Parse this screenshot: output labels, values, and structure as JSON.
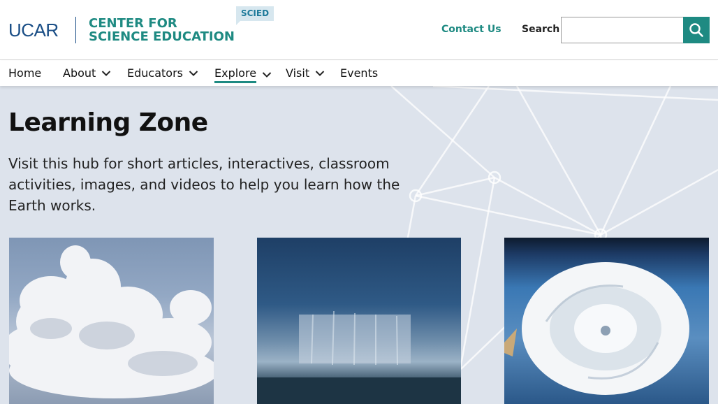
{
  "header": {
    "logo_text": "UCAR",
    "center_line1": "CENTER FOR",
    "center_line2": "SCIENCE EDUCATION",
    "badge": "SCIED",
    "contact_label": "Contact Us",
    "search_label": "Search",
    "search_value": "",
    "colors": {
      "brand_teal": "#1e8a82",
      "ucar_blue": "#1a4e86"
    }
  },
  "nav": {
    "items": [
      {
        "label": "Home",
        "has_dropdown": false
      },
      {
        "label": "About",
        "has_dropdown": true
      },
      {
        "label": "Educators",
        "has_dropdown": true
      },
      {
        "label": "Explore",
        "has_dropdown": true,
        "active": true
      },
      {
        "label": "Visit",
        "has_dropdown": true
      },
      {
        "label": "Events",
        "has_dropdown": false
      }
    ]
  },
  "hero": {
    "title": "Learning Zone",
    "intro": "Visit this hub for short articles, interactives, classroom activities, images, and videos to help you learn how the Earth works."
  },
  "cards": [
    {
      "image": "clouds-photo"
    },
    {
      "image": "rain-shower-photo"
    },
    {
      "image": "hurricane-satellite-photo"
    }
  ]
}
